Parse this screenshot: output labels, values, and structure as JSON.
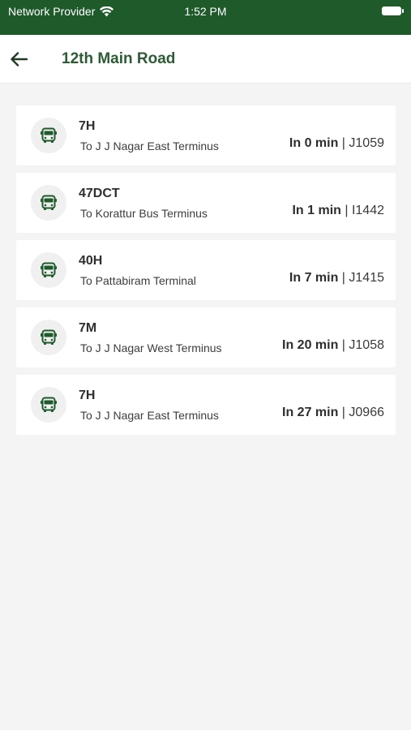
{
  "status_bar": {
    "carrier": "Network Provider",
    "time": "1:52 PM",
    "icons": [
      "wifi-icon",
      "battery-icon"
    ]
  },
  "header": {
    "back_icon": "back-arrow-icon",
    "title": "12th Main Road"
  },
  "buses": [
    {
      "route": "7H",
      "destination": "To J J Nagar East Terminus",
      "eta": "In 0 min",
      "separator": " | ",
      "vehicle": "J1059"
    },
    {
      "route": "47DCT",
      "destination": "To Korattur Bus Terminus",
      "eta": "In 1 min",
      "separator": " | ",
      "vehicle": "I1442"
    },
    {
      "route": "40H",
      "destination": "To Pattabiram Terminal",
      "eta": "In 7 min",
      "separator": " | ",
      "vehicle": "J1415"
    },
    {
      "route": "7M",
      "destination": "To J J Nagar West Terminus",
      "eta": "In 20 min",
      "separator": " | ",
      "vehicle": "J1058"
    },
    {
      "route": "7H",
      "destination": "To J J Nagar East Terminus",
      "eta": "In 27 min",
      "separator": " | ",
      "vehicle": "J0966"
    }
  ],
  "colors": {
    "status_bar": "#1f5a2b",
    "title": "#2d5b35",
    "icon": "#1f5a2b",
    "background": "#f4f4f4"
  }
}
